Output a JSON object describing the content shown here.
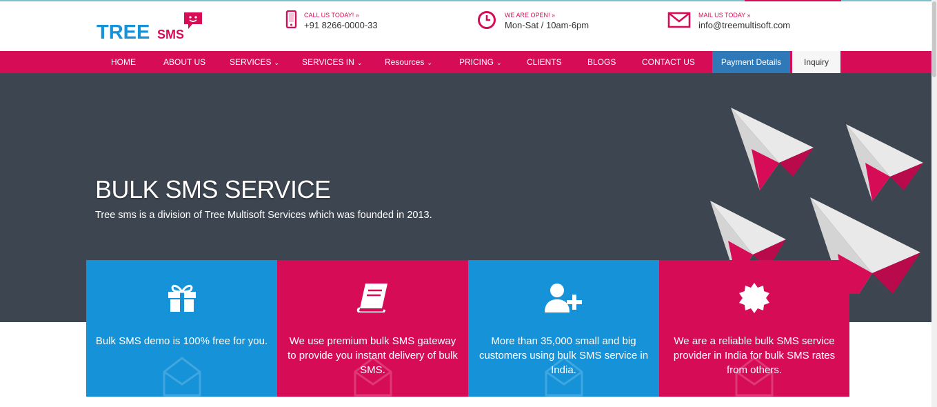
{
  "brand": {
    "name_part1": "TREE",
    "name_part2": "SMS"
  },
  "contacts": [
    {
      "label": "CALL US TODAY! »",
      "value": "+91 8266-0000-33",
      "icon": "phone-icon"
    },
    {
      "label": "WE ARE OPEN! »",
      "value": "Mon-Sat / 10am-6pm",
      "icon": "clock-icon"
    },
    {
      "label": "MAIL US TODAY »",
      "value": "info@treemultisoft.com",
      "icon": "mail-icon"
    }
  ],
  "nav": {
    "items": [
      {
        "label": "HOME"
      },
      {
        "label": "ABOUT US"
      },
      {
        "label": "SERVICES",
        "dropdown": true
      },
      {
        "label": "SERVICES IN",
        "dropdown": true
      },
      {
        "label": "Resources",
        "dropdown": true
      },
      {
        "label": "PRICING",
        "dropdown": true
      },
      {
        "label": "CLIENTS"
      },
      {
        "label": "BLOGS"
      },
      {
        "label": "CONTACT US"
      }
    ],
    "payment_button": "Payment Details",
    "inquiry_button": "Inquiry"
  },
  "hero": {
    "title": "BULK SMS SERVICE",
    "subtitle": "Tree sms is a division of Tree Multisoft Services which was founded in 2013."
  },
  "features": [
    {
      "icon": "gift-icon",
      "text": "Bulk SMS demo is 100% free for you.",
      "color": "#1592d8"
    },
    {
      "icon": "book-icon",
      "text": "We use premium bulk SMS gateway to provide you instant delivery of bulk SMS.",
      "color": "#d70c57"
    },
    {
      "icon": "user-plus-icon",
      "text": "More than 35,000 small and big customers using bulk SMS service in India.",
      "color": "#1592d8"
    },
    {
      "icon": "certificate-icon",
      "text": "We are a reliable bulk SMS service provider in India for bulk SMS rates from others.",
      "color": "#d70c57"
    }
  ],
  "colors": {
    "primary_pink": "#d70c57",
    "primary_blue": "#1592d8",
    "hero_bg": "#3d4550",
    "payment_blue": "#2f79b9"
  }
}
